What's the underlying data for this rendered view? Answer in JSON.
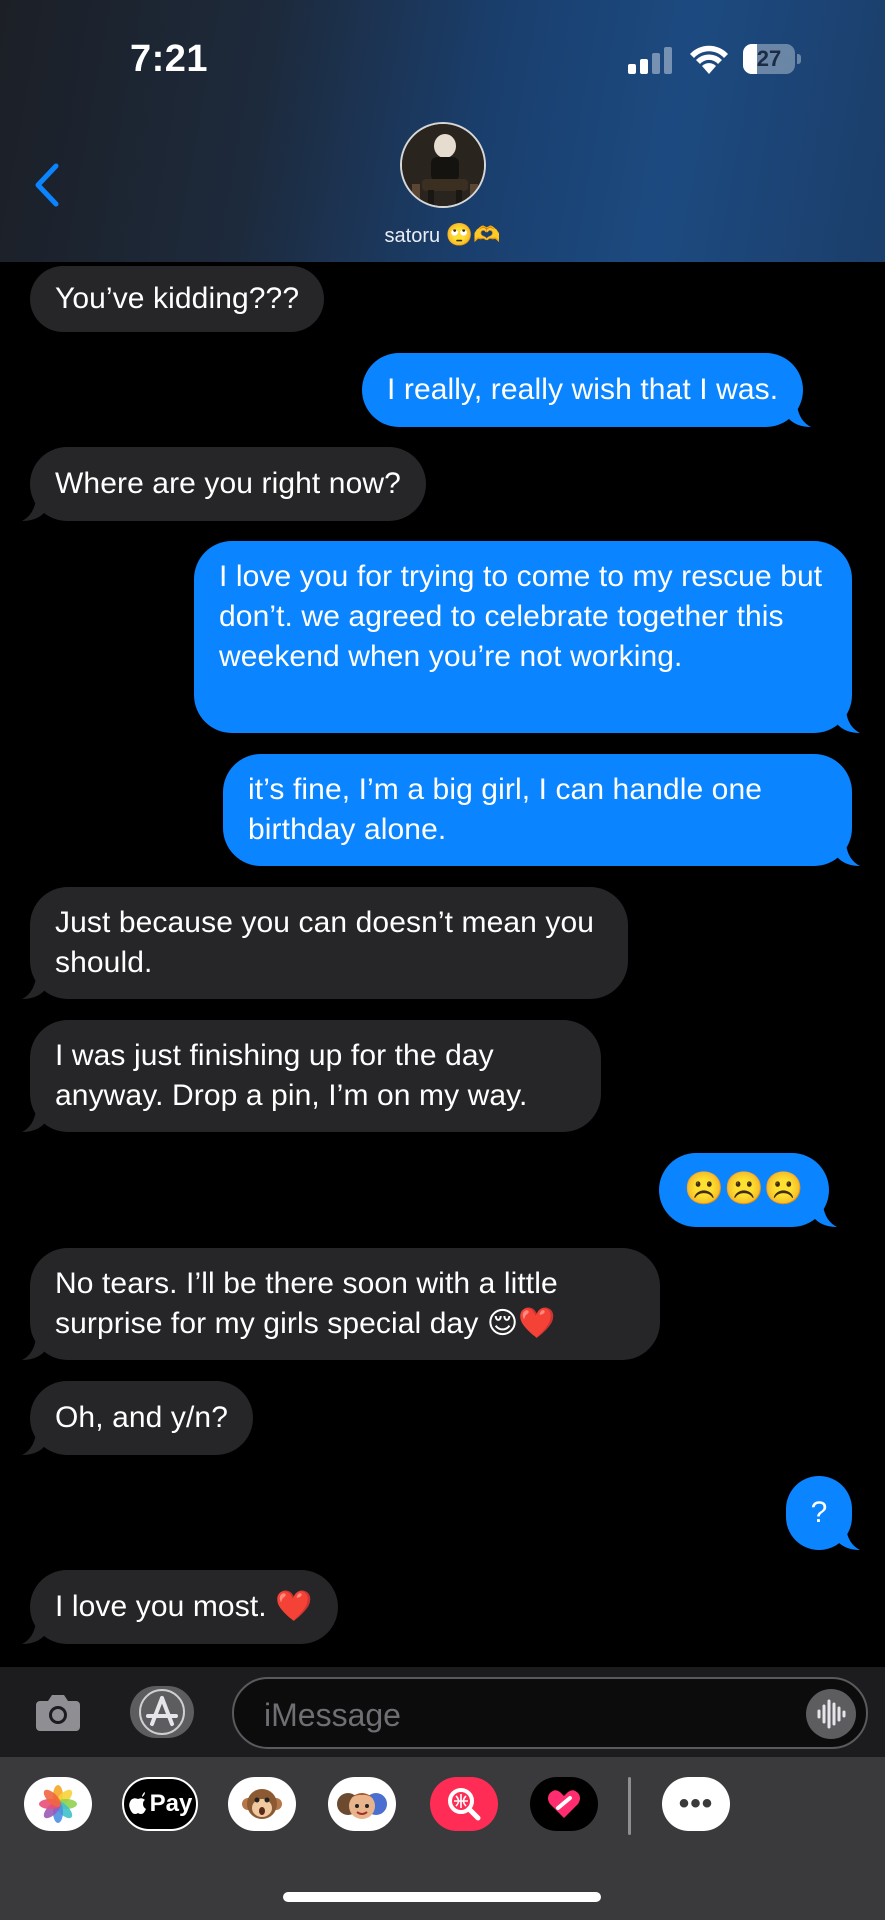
{
  "status_bar": {
    "time": "7:21",
    "battery": "27",
    "battery_level": 0.27
  },
  "header": {
    "contact_name": "satoru",
    "contact_emojis": "🙄🫶"
  },
  "messages": [
    {
      "direction": "incoming",
      "text": "You’ve kidding???"
    },
    {
      "direction": "outgoing",
      "text": "I really, really wish that I was."
    },
    {
      "direction": "incoming",
      "text": "Where are you right now?"
    },
    {
      "direction": "outgoing",
      "text": "I love you for trying to come to my rescue but don’t. we agreed to celebrate together this weekend when you’re not working."
    },
    {
      "direction": "outgoing",
      "text": "it’s fine, I’m a big girl, I can handle one birthday alone."
    },
    {
      "direction": "incoming",
      "text": "Just because you can doesn’t mean you should."
    },
    {
      "direction": "incoming",
      "text": "I was just finishing up for the day anyway. Drop a pin, I’m on my way."
    },
    {
      "direction": "outgoing",
      "text": "☹️☹️☹️"
    },
    {
      "direction": "incoming",
      "text": "No tears. I’ll be there soon with a little surprise for my girls special day 😌❤️"
    },
    {
      "direction": "incoming",
      "text": "Oh, and y/n?"
    },
    {
      "direction": "outgoing",
      "text": "?"
    },
    {
      "direction": "incoming",
      "text": "I love you most. ❤️"
    }
  ],
  "input": {
    "placeholder": "iMessage"
  },
  "drawer": {
    "apple_pay_label": "Pay",
    "more_label": "•••",
    "apps": [
      "photos-icon",
      "apple-pay-icon",
      "memoji-monkey-icon",
      "memoji-stickers-icon",
      "image-search-icon",
      "digital-touch-icon",
      "more-icon"
    ]
  },
  "colors": {
    "outgoing_bubble": "#0a84ff",
    "incoming_bubble": "#262628",
    "background": "#000000"
  }
}
